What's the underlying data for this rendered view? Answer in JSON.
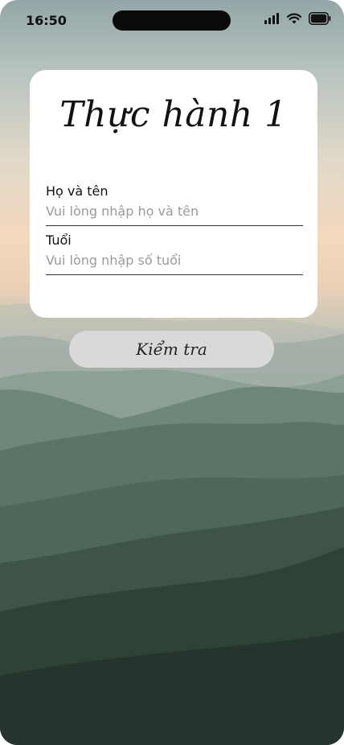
{
  "status_bar": {
    "time": "16:50"
  },
  "form": {
    "title": "Thực hành 1",
    "name_field": {
      "label": "Họ và tên",
      "placeholder": "Vui lòng nhập họ và tên",
      "value": ""
    },
    "age_field": {
      "label": "Tuổi",
      "placeholder": "Vui lòng nhập số tuổi",
      "value": ""
    }
  },
  "check_button": {
    "label": "Kiểm tra"
  },
  "colors": {
    "card_bg": "#ffffff",
    "button_bg": "#d9d9d9",
    "text": "#111111",
    "placeholder": "#9a9a9a"
  },
  "icons": [
    "cellular-signal-icon",
    "wifi-icon",
    "battery-icon"
  ]
}
